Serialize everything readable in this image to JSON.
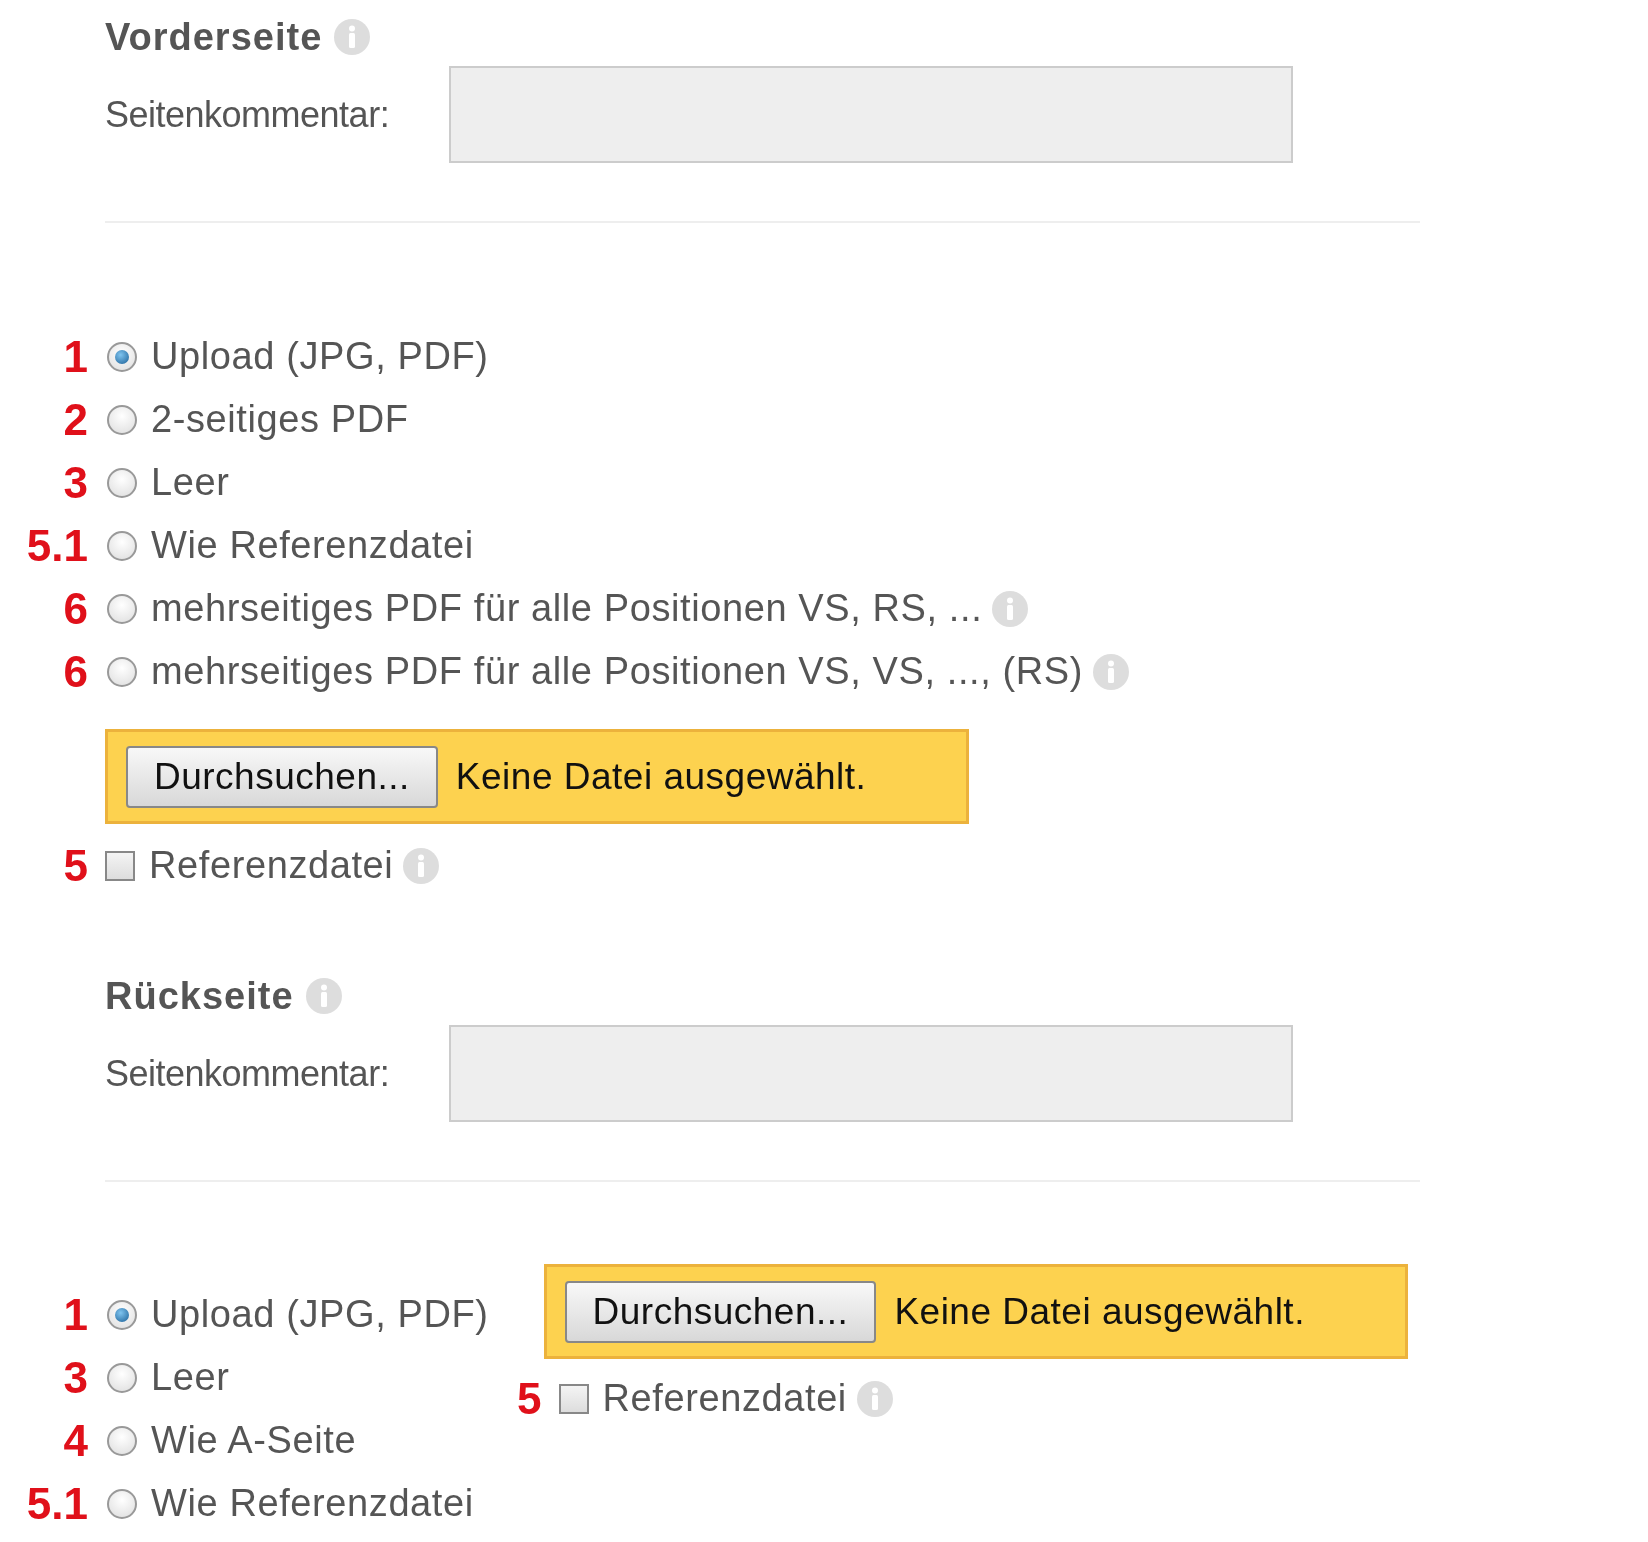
{
  "sections": [
    {
      "title": "Vorderseite",
      "info": true,
      "comment_label": "Seitenkommentar:",
      "kind": "stacked",
      "options": [
        {
          "marker": "1",
          "label": "Upload (JPG, PDF)",
          "selected": true,
          "info": false
        },
        {
          "marker": "2",
          "label": "2-seitiges PDF",
          "selected": false,
          "info": false
        },
        {
          "marker": "3",
          "label": "Leer",
          "selected": false,
          "info": false
        },
        {
          "marker": "5.1",
          "label": "Wie Referenzdatei",
          "selected": false,
          "info": false
        },
        {
          "marker": "6",
          "label": "mehrseitiges PDF für alle Positionen VS, RS, ...",
          "selected": false,
          "info": true
        },
        {
          "marker": "6",
          "label": "mehrseitiges PDF für alle Positionen VS, VS, ..., (RS)",
          "selected": false,
          "info": true
        }
      ],
      "file": {
        "button": "Durchsuchen...",
        "status": "Keine Datei ausgewählt."
      },
      "reference": {
        "marker": "5",
        "label": "Referenzdatei",
        "checked": false,
        "info": true
      }
    },
    {
      "title": "Rückseite",
      "info": true,
      "comment_label": "Seitenkommentar:",
      "kind": "side",
      "options": [
        {
          "marker": "1",
          "label": "Upload (JPG, PDF)",
          "selected": true,
          "info": false
        },
        {
          "marker": "3",
          "label": "Leer",
          "selected": false,
          "info": false
        },
        {
          "marker": "4",
          "label": "Wie A-Seite",
          "selected": false,
          "info": false
        },
        {
          "marker": "5.1",
          "label": "Wie Referenzdatei",
          "selected": false,
          "info": false
        }
      ],
      "file": {
        "button": "Durchsuchen...",
        "status": "Keine Datei ausgewählt."
      },
      "reference": {
        "marker": "5",
        "label": "Referenzdatei",
        "checked": false,
        "info": true
      }
    }
  ]
}
